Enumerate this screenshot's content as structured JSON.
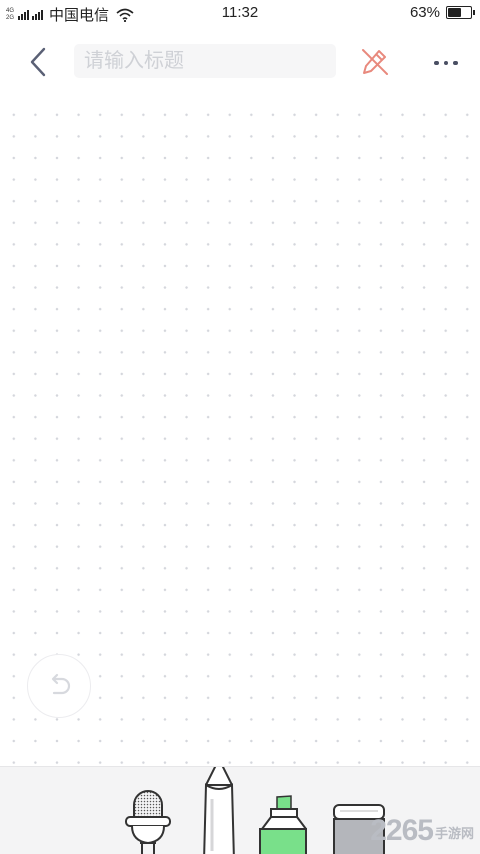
{
  "status_bar": {
    "net_top": "4G",
    "net_bottom": "2G",
    "carrier": "中国电信",
    "time": "11:32",
    "battery_percent_text": "63%",
    "battery_level": 0.63
  },
  "toolbar": {
    "title_placeholder": "请输入标题",
    "title_value": "",
    "pen_icon": "pen-disabled-icon",
    "pen_icon_color": "#e8897d",
    "more_icon": "more-dots-icon"
  },
  "canvas": {
    "background": "dot-grid",
    "dot_color": "#d4d6dc",
    "undo_icon": "undo-icon"
  },
  "tools": [
    {
      "name": "microphone",
      "icon": "microphone-icon"
    },
    {
      "name": "pen",
      "icon": "pen-icon"
    },
    {
      "name": "highlighter",
      "icon": "highlighter-icon",
      "color": "#79e08a"
    },
    {
      "name": "eraser",
      "icon": "eraser-icon"
    }
  ],
  "watermark": {
    "number": "2265",
    "text": "手游网"
  }
}
